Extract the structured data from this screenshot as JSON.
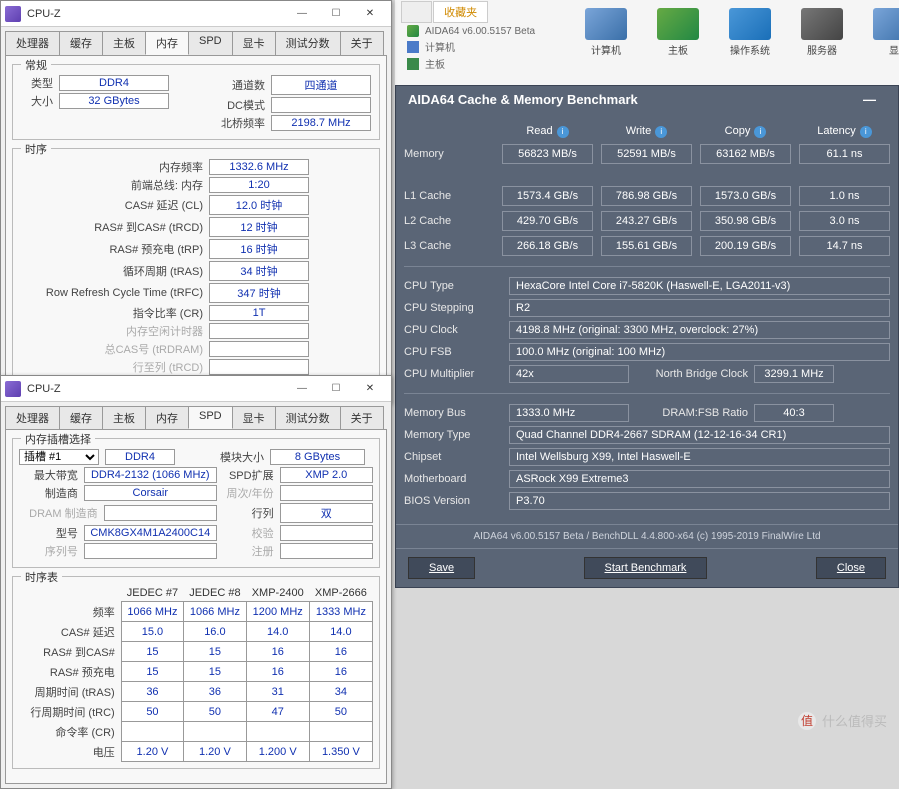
{
  "cpuz1": {
    "title": "CPU-Z",
    "tabs": [
      "处理器",
      "缓存",
      "主板",
      "内存",
      "SPD",
      "显卡",
      "测试分数",
      "关于"
    ],
    "active_tab": "内存",
    "group_general": "常规",
    "type_label": "类型",
    "type_value": "DDR4",
    "size_label": "大小",
    "size_value": "32 GBytes",
    "channels_label": "通道数",
    "channels_value": "四通道",
    "dcmode_label": "DC模式",
    "dcmode_value": "",
    "nbfreq_label": "北桥频率",
    "nbfreq_value": "2198.7 MHz",
    "group_timings": "时序",
    "dramfreq_label": "内存频率",
    "dramfreq_value": "1332.6 MHz",
    "fsbdram_label": "前端总线: 内存",
    "fsbdram_value": "1:20",
    "cl_label": "CAS# 延迟 (CL)",
    "cl_value": "12.0 时钟",
    "trcd_label": "RAS# 到CAS# (tRCD)",
    "trcd_value": "12 时钟",
    "trp_label": "RAS# 预充电 (tRP)",
    "trp_value": "16 时钟",
    "tras_label": "循环周期 (tRAS)",
    "tras_value": "34 时钟",
    "trfc_label": "Row Refresh Cycle Time (tRFC)",
    "trfc_value": "347 时钟",
    "cr_label": "指令比率 (CR)",
    "cr_value": "1T",
    "idle_label": "内存空闲计时器",
    "trdram_label": "总CAS号 (tRDRAM)",
    "rtb_label": "行至列 (tRCD)"
  },
  "cpuz2": {
    "title": "CPU-Z",
    "tabs": [
      "处理器",
      "缓存",
      "主板",
      "内存",
      "SPD",
      "显卡",
      "测试分数",
      "关于"
    ],
    "active_tab": "SPD",
    "group_slot": "内存插槽选择",
    "slot_select": "插槽 #1",
    "slot_type": "DDR4",
    "modsize_label": "模块大小",
    "modsize_value": "8 GBytes",
    "maxbw_label": "最大带宽",
    "maxbw_value": "DDR4-2132 (1066 MHz)",
    "spdext_label": "SPD扩展",
    "spdext_value": "XMP 2.0",
    "manuf_label": "制造商",
    "manuf_value": "Corsair",
    "week_label": "周次/年份",
    "drammanuf_label": "DRAM 制造商",
    "ranks_label": "行列",
    "ranks_value": "双",
    "partnum_label": "型号",
    "partnum_value": "CMK8GX4M1A2400C14",
    "correction_label": "校验",
    "serial_label": "序列号",
    "registered_label": "注册",
    "group_timing": "时序表",
    "cols": [
      "JEDEC #7",
      "JEDEC #8",
      "XMP-2400",
      "XMP-2666"
    ],
    "rows": [
      {
        "k": "频率",
        "v": [
          "1066 MHz",
          "1066 MHz",
          "1200 MHz",
          "1333 MHz"
        ]
      },
      {
        "k": "CAS# 延迟",
        "v": [
          "15.0",
          "16.0",
          "14.0",
          "14.0"
        ]
      },
      {
        "k": "RAS# 到CAS#",
        "v": [
          "15",
          "15",
          "16",
          "16"
        ]
      },
      {
        "k": "RAS# 预充电",
        "v": [
          "15",
          "15",
          "16",
          "16"
        ]
      },
      {
        "k": "周期时间 (tRAS)",
        "v": [
          "36",
          "36",
          "31",
          "34"
        ]
      },
      {
        "k": "行周期时间 (tRC)",
        "v": [
          "50",
          "50",
          "47",
          "50"
        ]
      },
      {
        "k": "命令率 (CR)",
        "v": [
          "",
          "",
          "",
          ""
        ]
      },
      {
        "k": "电压",
        "v": [
          "1.20 V",
          "1.20 V",
          "1.200 V",
          "1.350 V"
        ]
      }
    ]
  },
  "desktop": {
    "tabs": [
      "收藏夹"
    ],
    "sub1_name": "AIDA64 v6.00.5157 Beta",
    "sub2": "计算机",
    "sub3": "主板",
    "icons": [
      "计算机",
      "主板",
      "操作系统",
      "服务器",
      "显"
    ]
  },
  "aida": {
    "title": "AIDA64 Cache & Memory Benchmark",
    "cols": [
      "Read",
      "Write",
      "Copy",
      "Latency"
    ],
    "rows": [
      {
        "name": "Memory",
        "v": [
          "56823 MB/s",
          "52591 MB/s",
          "63162 MB/s",
          "61.1 ns"
        ]
      },
      {
        "name": "L1 Cache",
        "v": [
          "1573.4 GB/s",
          "786.98 GB/s",
          "1573.0 GB/s",
          "1.0 ns"
        ]
      },
      {
        "name": "L2 Cache",
        "v": [
          "429.70 GB/s",
          "243.27 GB/s",
          "350.98 GB/s",
          "3.0 ns"
        ]
      },
      {
        "name": "L3 Cache",
        "v": [
          "266.18 GB/s",
          "155.61 GB/s",
          "200.19 GB/s",
          "14.7 ns"
        ]
      }
    ],
    "specs": [
      {
        "k": "CPU Type",
        "v": "HexaCore Intel Core i7-5820K  (Haswell-E, LGA2011-v3)"
      },
      {
        "k": "CPU Stepping",
        "v": "R2"
      },
      {
        "k": "CPU Clock",
        "v": "4198.8 MHz  (original: 3300 MHz, overclock: 27%)"
      },
      {
        "k": "CPU FSB",
        "v": "100.0 MHz  (original: 100 MHz)"
      },
      {
        "k": "CPU Multiplier",
        "v": "42x",
        "k2": "North Bridge Clock",
        "v2": "3299.1 MHz"
      }
    ],
    "specs2": [
      {
        "k": "Memory Bus",
        "v": "1333.0 MHz",
        "k2": "DRAM:FSB Ratio",
        "v2": "40:3"
      },
      {
        "k": "Memory Type",
        "v": "Quad Channel DDR4-2667 SDRAM  (12-12-16-34 CR1)"
      },
      {
        "k": "Chipset",
        "v": "Intel Wellsburg X99, Intel Haswell-E"
      },
      {
        "k": "Motherboard",
        "v": "ASRock X99 Extreme3"
      },
      {
        "k": "BIOS Version",
        "v": "P3.70"
      }
    ],
    "footer": "AIDA64 v6.00.5157 Beta / BenchDLL 4.4.800-x64  (c) 1995-2019 FinalWire Ltd",
    "btn_save": "Save",
    "btn_start": "Start Benchmark",
    "btn_close": "Close"
  },
  "watermark": "什么值得买"
}
